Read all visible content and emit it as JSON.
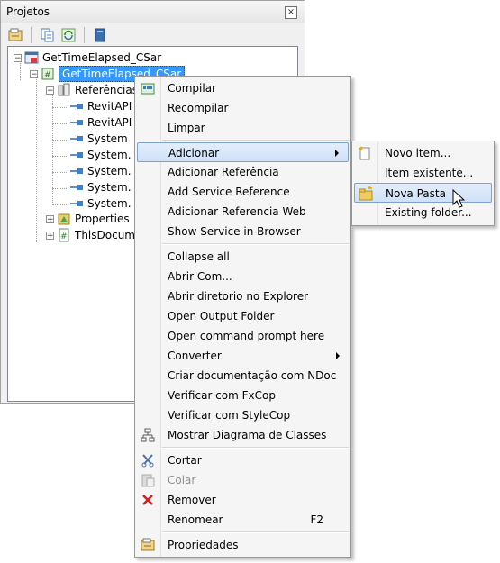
{
  "panel": {
    "title": "Projetos",
    "close_label": "×"
  },
  "toolbar": {
    "icons": [
      "properties-icon",
      "show-all-files-icon",
      "refresh-icon",
      "collapse-icon"
    ]
  },
  "tree": {
    "solution": "GetTimeElapsed_CSar",
    "project": "GetTimeElapsed_CSar",
    "references_label": "Referências",
    "references": [
      "RevitAPI",
      "RevitAPI",
      "System",
      "System.",
      "System.",
      "System.",
      "System."
    ],
    "properties_label": "Properties",
    "thisdocument_label": "ThisDocum"
  },
  "menu": {
    "items": [
      {
        "label": "Compilar",
        "icon": "build-icon"
      },
      {
        "label": "Recompilar"
      },
      {
        "label": "Limpar"
      },
      {
        "label": "Adicionar",
        "submenu": true
      },
      {
        "label": "Adicionar Referência"
      },
      {
        "label": "Add Service Reference"
      },
      {
        "label": "Adicionar Referencia Web"
      },
      {
        "label": "Show Service in Browser"
      },
      {
        "label": "Collapse all"
      },
      {
        "label": "Abrir Com..."
      },
      {
        "label": "Abrir diretorio no Explorer"
      },
      {
        "label": "Open Output Folder"
      },
      {
        "label": "Open command prompt here"
      },
      {
        "label": "Converter",
        "submenu": true
      },
      {
        "label": "Criar documentação com NDoc"
      },
      {
        "label": "Verificar com FxCop"
      },
      {
        "label": "Verificar com StyleCop"
      },
      {
        "label": "Mostrar Diagrama de Classes",
        "icon": "class-diagram-icon"
      },
      {
        "label": "Cortar",
        "icon": "cut-icon"
      },
      {
        "label": "Colar",
        "icon": "paste-icon",
        "disabled": true
      },
      {
        "label": "Remover",
        "icon": "delete-icon"
      },
      {
        "label": "Renomear",
        "shortcut": "F2"
      },
      {
        "label": "Propriedades",
        "icon": "properties-icon"
      }
    ]
  },
  "submenu": {
    "items": [
      {
        "label": "Novo item...",
        "icon": "new-item-icon"
      },
      {
        "label": "Item existente..."
      },
      {
        "label": "Nova Pasta",
        "icon": "new-folder-icon"
      },
      {
        "label": "Existing folder..."
      }
    ]
  },
  "colors": {
    "selection": "#3399ff",
    "highlight_border": "#7da2ce",
    "menu_bg": "#f5f5f5"
  }
}
